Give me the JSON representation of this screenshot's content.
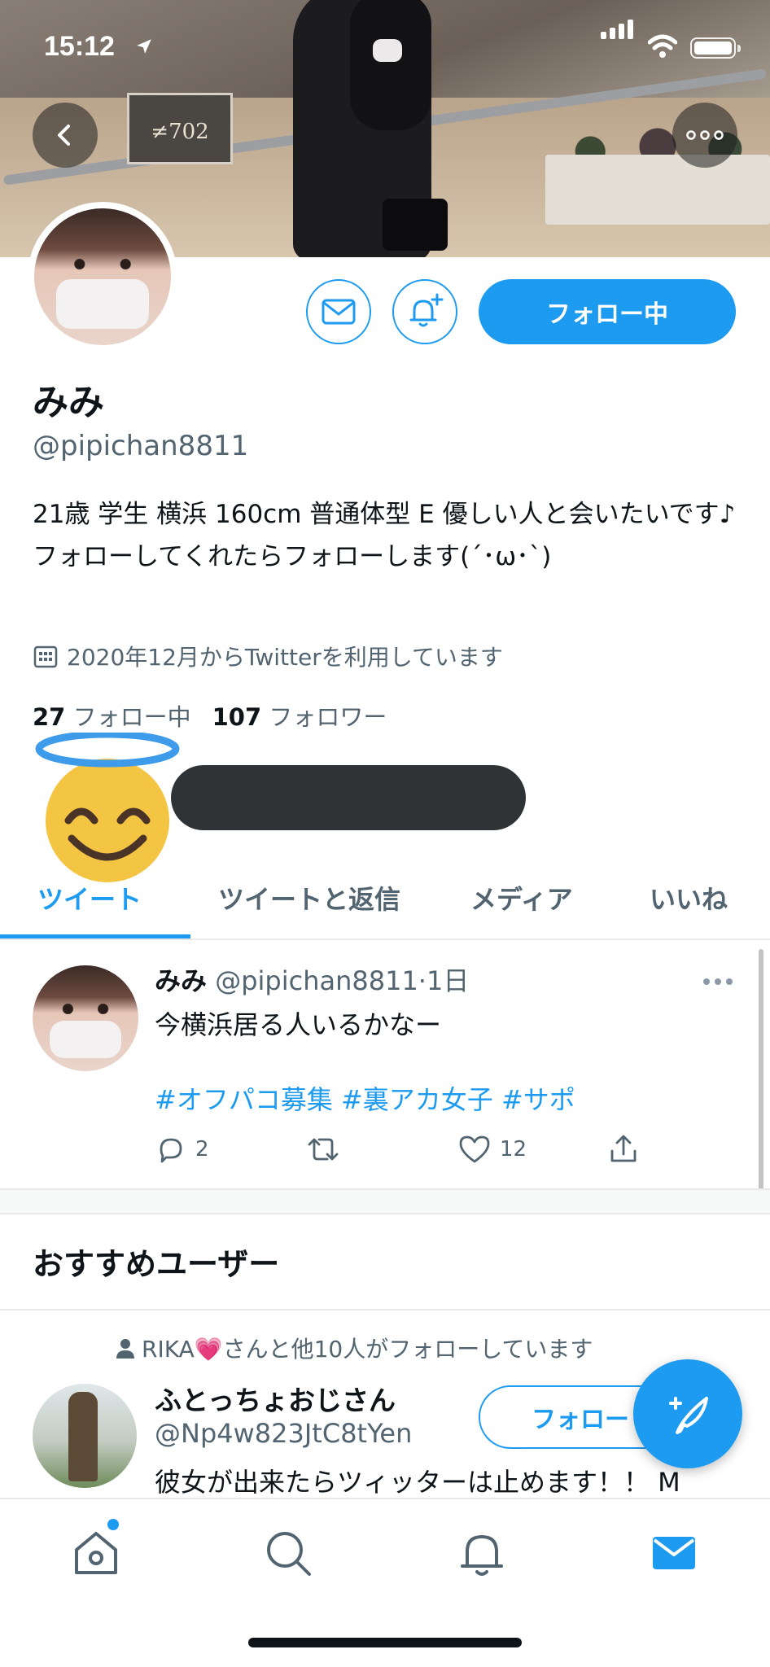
{
  "status_bar": {
    "time": "15:12"
  },
  "profile": {
    "name": "みみ",
    "handle": "@pipichan8811",
    "bio": "21歳 学生 横浜 160cm 普通体型 E 優しい人と会いたいです♪ フォローしてくれたらフォローします(´･ω･`)",
    "joined": "2020年12月からTwitterを利用しています",
    "following_count": "27",
    "following_label": "フォロー中",
    "followers_count": "107",
    "followers_label": "フォロワー",
    "follow_button_label": "フォロー中",
    "banner_sign_text": "≠702"
  },
  "tabs": [
    {
      "label": "ツイート",
      "active": true
    },
    {
      "label": "ツイートと返信",
      "active": false
    },
    {
      "label": "メディア",
      "active": false
    },
    {
      "label": "いいね",
      "active": false
    }
  ],
  "tweet": {
    "author": "みみ",
    "handle": "@pipichan8811",
    "time": "·1日",
    "text": "今横浜居る人いるかなー",
    "hashtags": "#オフパコ募集 #裏アカ女子 #サポ",
    "replies": "2",
    "likes": "12"
  },
  "recommended": {
    "title": "おすすめユーザー",
    "social_context": "RIKA💗さんと他10人がフォローしています",
    "user": {
      "name": "ふとっちょおじさん",
      "handle": "@Np4w823JtC8tYen",
      "bio": "彼女が出来たらツィッターは止めます！！ M",
      "follow_label": "フォロー"
    }
  },
  "colors": {
    "accent": "#1d9bf0",
    "text_primary": "#0f1419",
    "text_secondary": "#536471",
    "divider": "#e7e9ea"
  },
  "icons": {
    "back": "chevron-left-icon",
    "more": "more-horizontal-icon",
    "message": "envelope-icon",
    "notify": "bell-plus-icon",
    "calendar": "calendar-icon",
    "reply": "reply-icon",
    "retweet": "retweet-icon",
    "like": "heart-icon",
    "share": "share-icon",
    "compose": "feather-plus-icon",
    "nav_home": "home-icon",
    "nav_search": "search-icon",
    "nav_notifications": "bell-icon",
    "nav_messages": "mail-icon"
  }
}
